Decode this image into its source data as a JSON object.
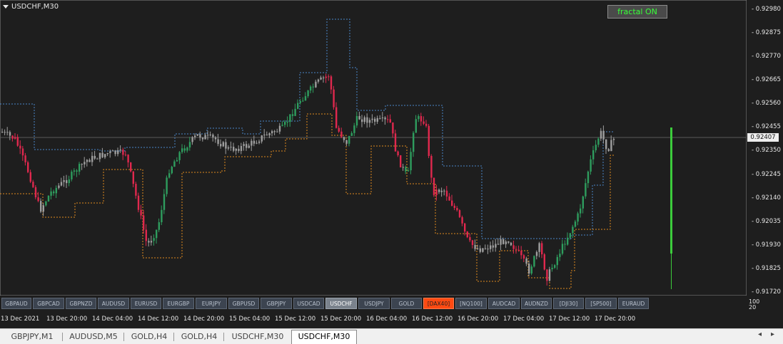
{
  "chart": {
    "symbol_label": "USDCHF,M30",
    "fractal_button": "fractal ON",
    "current_price": "0.92407",
    "price_ticks": [
      "0.92980",
      "0.92875",
      "0.92770",
      "0.92665",
      "0.92560",
      "0.92455",
      "0.92350",
      "0.92245",
      "0.92140",
      "0.92035",
      "0.91930",
      "0.91825",
      "0.91720"
    ],
    "sub_axis": [
      "100",
      "20"
    ],
    "colors": {
      "bull": "#2e9d5e",
      "bear": "#e0284e",
      "neutral": "#9e9e9e",
      "upper_band": "#4a86c8",
      "lower_band": "#e08a1e",
      "volume_bar": "#3ccc3c"
    }
  },
  "symbols": [
    {
      "label": "GBPAUD",
      "w": 42
    },
    {
      "label": "GBPCAD",
      "w": 44
    },
    {
      "label": "GBPNZD",
      "w": 43
    },
    {
      "label": "AUDUSD",
      "w": 44
    },
    {
      "label": "EURUSD",
      "w": 43
    },
    {
      "label": "EURGBP",
      "w": 44
    },
    {
      "label": "EURJPY",
      "w": 44
    },
    {
      "label": "GBPUSD",
      "w": 43
    },
    {
      "label": "GBPJPY",
      "w": 44
    },
    {
      "label": "USDCAD",
      "w": 43
    },
    {
      "label": "USDCHF",
      "w": 44,
      "active": true
    },
    {
      "label": "USDJPY",
      "w": 44
    },
    {
      "label": "GOLD",
      "w": 43
    },
    {
      "label": "[DAX40]",
      "w": 43,
      "hl": true
    },
    {
      "label": "[NQ100]",
      "w": 44
    },
    {
      "label": "AUDCAD",
      "w": 44
    },
    {
      "label": "AUDNZD",
      "w": 43
    },
    {
      "label": "[DJI30]",
      "w": 43
    },
    {
      "label": "[SP500]",
      "w": 44
    },
    {
      "label": "EURAUD",
      "w": 43
    }
  ],
  "time_labels": [
    "13 Dec 2021",
    "13 Dec 20:00",
    "14 Dec 04:00",
    "14 Dec 12:00",
    "14 Dec 20:00",
    "15 Dec 04:00",
    "15 Dec 12:00",
    "15 Dec 20:00",
    "16 Dec 04:00",
    "16 Dec 12:00",
    "16 Dec 20:00",
    "17 Dec 04:00",
    "17 Dec 12:00",
    "17 Dec 20:00"
  ],
  "tabs": [
    "GBPJPY,M1",
    "AUDUSD,M5",
    "GOLD,H4",
    "GOLD,H4",
    "USDCHF,M30",
    "USDCHF,M30"
  ],
  "active_tab": 5
}
